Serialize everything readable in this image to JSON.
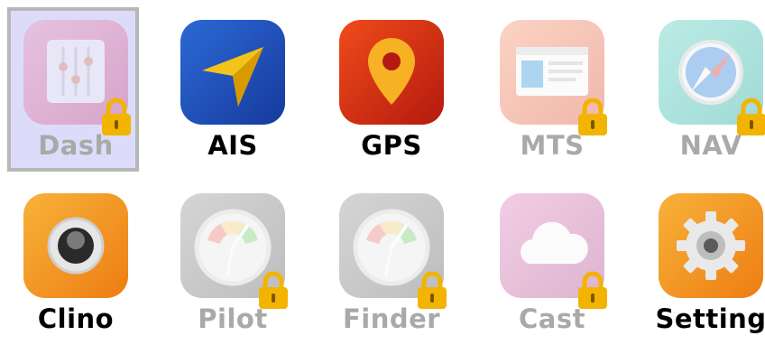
{
  "apps": [
    {
      "label": "Dash",
      "icon": "sliders-icon",
      "locked": true,
      "selected": true,
      "bg": "#e57fa7"
    },
    {
      "label": "AIS",
      "icon": "navigation-arrow-icon",
      "locked": false,
      "bg": "#1f4fb8"
    },
    {
      "label": "GPS",
      "icon": "map-pin-icon",
      "locked": false,
      "bg": "#d22a12"
    },
    {
      "label": "MTS",
      "icon": "browser-window-icon",
      "locked": true,
      "bg": "#f07a5a"
    },
    {
      "label": "NAV",
      "icon": "compass-icon",
      "locked": true,
      "bg": "#4cc7bd"
    },
    {
      "label": "Clino",
      "icon": "joystick-icon",
      "locked": false,
      "bg": "#f29a1d"
    },
    {
      "label": "Pilot",
      "icon": "gauge-icon",
      "locked": true,
      "bg": "#8a8a8a"
    },
    {
      "label": "Finder",
      "icon": "gauge-icon",
      "locked": true,
      "bg": "#8a8a8a"
    },
    {
      "label": "Cast",
      "icon": "cloud-icon",
      "locked": true,
      "bg": "#c86aa6"
    },
    {
      "label": "Setting",
      "icon": "gear-icon",
      "locked": false,
      "bg": "#f09a1a"
    }
  ],
  "lock_icon": "padlock-icon",
  "colors": {
    "selected_bg": "#dcdcfa",
    "selected_border": "#b7b7b7",
    "locked_label": "#a9a9a9",
    "lock": "#f2b400"
  }
}
